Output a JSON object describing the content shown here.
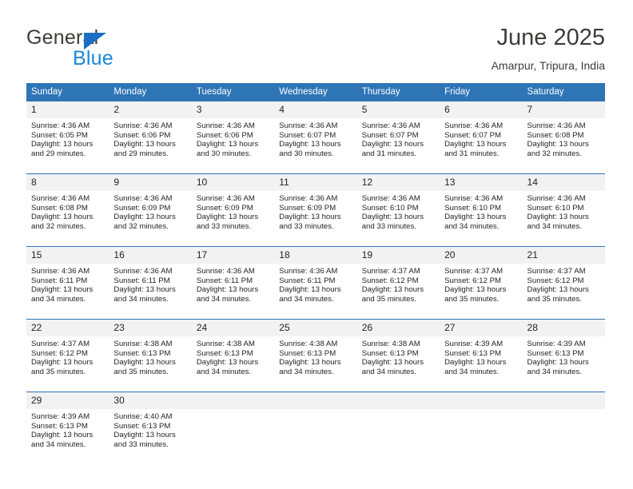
{
  "logo": {
    "word_one": "General",
    "word_two": "Blue",
    "triangle_color": "#1b6ec2",
    "word_one_color": "#3c3c3b",
    "word_two_color": "#1b87d8"
  },
  "header": {
    "title": "June 2025",
    "subtitle": "Amarpur, Tripura, India"
  },
  "theme": {
    "header_blue": "#2e75b6",
    "daynum_band": "#f2f2f2",
    "text": "#231f20"
  },
  "labels": {
    "sunrise_prefix": "Sunrise:",
    "sunset_prefix": "Sunset:",
    "daylight_prefix": "Daylight:"
  },
  "weekday_headers": [
    "Sunday",
    "Monday",
    "Tuesday",
    "Wednesday",
    "Thursday",
    "Friday",
    "Saturday"
  ],
  "weeks": [
    [
      {
        "day": "1",
        "sunrise": "Sunrise: 4:36 AM",
        "sunset": "Sunset: 6:05 PM",
        "daylight_line1": "Daylight: 13 hours",
        "daylight_line2": "and 29 minutes."
      },
      {
        "day": "2",
        "sunrise": "Sunrise: 4:36 AM",
        "sunset": "Sunset: 6:06 PM",
        "daylight_line1": "Daylight: 13 hours",
        "daylight_line2": "and 29 minutes."
      },
      {
        "day": "3",
        "sunrise": "Sunrise: 4:36 AM",
        "sunset": "Sunset: 6:06 PM",
        "daylight_line1": "Daylight: 13 hours",
        "daylight_line2": "and 30 minutes."
      },
      {
        "day": "4",
        "sunrise": "Sunrise: 4:36 AM",
        "sunset": "Sunset: 6:07 PM",
        "daylight_line1": "Daylight: 13 hours",
        "daylight_line2": "and 30 minutes."
      },
      {
        "day": "5",
        "sunrise": "Sunrise: 4:36 AM",
        "sunset": "Sunset: 6:07 PM",
        "daylight_line1": "Daylight: 13 hours",
        "daylight_line2": "and 31 minutes."
      },
      {
        "day": "6",
        "sunrise": "Sunrise: 4:36 AM",
        "sunset": "Sunset: 6:07 PM",
        "daylight_line1": "Daylight: 13 hours",
        "daylight_line2": "and 31 minutes."
      },
      {
        "day": "7",
        "sunrise": "Sunrise: 4:36 AM",
        "sunset": "Sunset: 6:08 PM",
        "daylight_line1": "Daylight: 13 hours",
        "daylight_line2": "and 32 minutes."
      }
    ],
    [
      {
        "day": "8",
        "sunrise": "Sunrise: 4:36 AM",
        "sunset": "Sunset: 6:08 PM",
        "daylight_line1": "Daylight: 13 hours",
        "daylight_line2": "and 32 minutes."
      },
      {
        "day": "9",
        "sunrise": "Sunrise: 4:36 AM",
        "sunset": "Sunset: 6:09 PM",
        "daylight_line1": "Daylight: 13 hours",
        "daylight_line2": "and 32 minutes."
      },
      {
        "day": "10",
        "sunrise": "Sunrise: 4:36 AM",
        "sunset": "Sunset: 6:09 PM",
        "daylight_line1": "Daylight: 13 hours",
        "daylight_line2": "and 33 minutes."
      },
      {
        "day": "11",
        "sunrise": "Sunrise: 4:36 AM",
        "sunset": "Sunset: 6:09 PM",
        "daylight_line1": "Daylight: 13 hours",
        "daylight_line2": "and 33 minutes."
      },
      {
        "day": "12",
        "sunrise": "Sunrise: 4:36 AM",
        "sunset": "Sunset: 6:10 PM",
        "daylight_line1": "Daylight: 13 hours",
        "daylight_line2": "and 33 minutes."
      },
      {
        "day": "13",
        "sunrise": "Sunrise: 4:36 AM",
        "sunset": "Sunset: 6:10 PM",
        "daylight_line1": "Daylight: 13 hours",
        "daylight_line2": "and 34 minutes."
      },
      {
        "day": "14",
        "sunrise": "Sunrise: 4:36 AM",
        "sunset": "Sunset: 6:10 PM",
        "daylight_line1": "Daylight: 13 hours",
        "daylight_line2": "and 34 minutes."
      }
    ],
    [
      {
        "day": "15",
        "sunrise": "Sunrise: 4:36 AM",
        "sunset": "Sunset: 6:11 PM",
        "daylight_line1": "Daylight: 13 hours",
        "daylight_line2": "and 34 minutes."
      },
      {
        "day": "16",
        "sunrise": "Sunrise: 4:36 AM",
        "sunset": "Sunset: 6:11 PM",
        "daylight_line1": "Daylight: 13 hours",
        "daylight_line2": "and 34 minutes."
      },
      {
        "day": "17",
        "sunrise": "Sunrise: 4:36 AM",
        "sunset": "Sunset: 6:11 PM",
        "daylight_line1": "Daylight: 13 hours",
        "daylight_line2": "and 34 minutes."
      },
      {
        "day": "18",
        "sunrise": "Sunrise: 4:36 AM",
        "sunset": "Sunset: 6:11 PM",
        "daylight_line1": "Daylight: 13 hours",
        "daylight_line2": "and 34 minutes."
      },
      {
        "day": "19",
        "sunrise": "Sunrise: 4:37 AM",
        "sunset": "Sunset: 6:12 PM",
        "daylight_line1": "Daylight: 13 hours",
        "daylight_line2": "and 35 minutes."
      },
      {
        "day": "20",
        "sunrise": "Sunrise: 4:37 AM",
        "sunset": "Sunset: 6:12 PM",
        "daylight_line1": "Daylight: 13 hours",
        "daylight_line2": "and 35 minutes."
      },
      {
        "day": "21",
        "sunrise": "Sunrise: 4:37 AM",
        "sunset": "Sunset: 6:12 PM",
        "daylight_line1": "Daylight: 13 hours",
        "daylight_line2": "and 35 minutes."
      }
    ],
    [
      {
        "day": "22",
        "sunrise": "Sunrise: 4:37 AM",
        "sunset": "Sunset: 6:12 PM",
        "daylight_line1": "Daylight: 13 hours",
        "daylight_line2": "and 35 minutes."
      },
      {
        "day": "23",
        "sunrise": "Sunrise: 4:38 AM",
        "sunset": "Sunset: 6:13 PM",
        "daylight_line1": "Daylight: 13 hours",
        "daylight_line2": "and 35 minutes."
      },
      {
        "day": "24",
        "sunrise": "Sunrise: 4:38 AM",
        "sunset": "Sunset: 6:13 PM",
        "daylight_line1": "Daylight: 13 hours",
        "daylight_line2": "and 34 minutes."
      },
      {
        "day": "25",
        "sunrise": "Sunrise: 4:38 AM",
        "sunset": "Sunset: 6:13 PM",
        "daylight_line1": "Daylight: 13 hours",
        "daylight_line2": "and 34 minutes."
      },
      {
        "day": "26",
        "sunrise": "Sunrise: 4:38 AM",
        "sunset": "Sunset: 6:13 PM",
        "daylight_line1": "Daylight: 13 hours",
        "daylight_line2": "and 34 minutes."
      },
      {
        "day": "27",
        "sunrise": "Sunrise: 4:39 AM",
        "sunset": "Sunset: 6:13 PM",
        "daylight_line1": "Daylight: 13 hours",
        "daylight_line2": "and 34 minutes."
      },
      {
        "day": "28",
        "sunrise": "Sunrise: 4:39 AM",
        "sunset": "Sunset: 6:13 PM",
        "daylight_line1": "Daylight: 13 hours",
        "daylight_line2": "and 34 minutes."
      }
    ],
    [
      {
        "day": "29",
        "sunrise": "Sunrise: 4:39 AM",
        "sunset": "Sunset: 6:13 PM",
        "daylight_line1": "Daylight: 13 hours",
        "daylight_line2": "and 34 minutes."
      },
      {
        "day": "30",
        "sunrise": "Sunrise: 4:40 AM",
        "sunset": "Sunset: 6:13 PM",
        "daylight_line1": "Daylight: 13 hours",
        "daylight_line2": "and 33 minutes."
      },
      {
        "day": "",
        "sunrise": "",
        "sunset": "",
        "daylight_line1": "",
        "daylight_line2": ""
      },
      {
        "day": "",
        "sunrise": "",
        "sunset": "",
        "daylight_line1": "",
        "daylight_line2": ""
      },
      {
        "day": "",
        "sunrise": "",
        "sunset": "",
        "daylight_line1": "",
        "daylight_line2": ""
      },
      {
        "day": "",
        "sunrise": "",
        "sunset": "",
        "daylight_line1": "",
        "daylight_line2": ""
      },
      {
        "day": "",
        "sunrise": "",
        "sunset": "",
        "daylight_line1": "",
        "daylight_line2": ""
      }
    ]
  ]
}
